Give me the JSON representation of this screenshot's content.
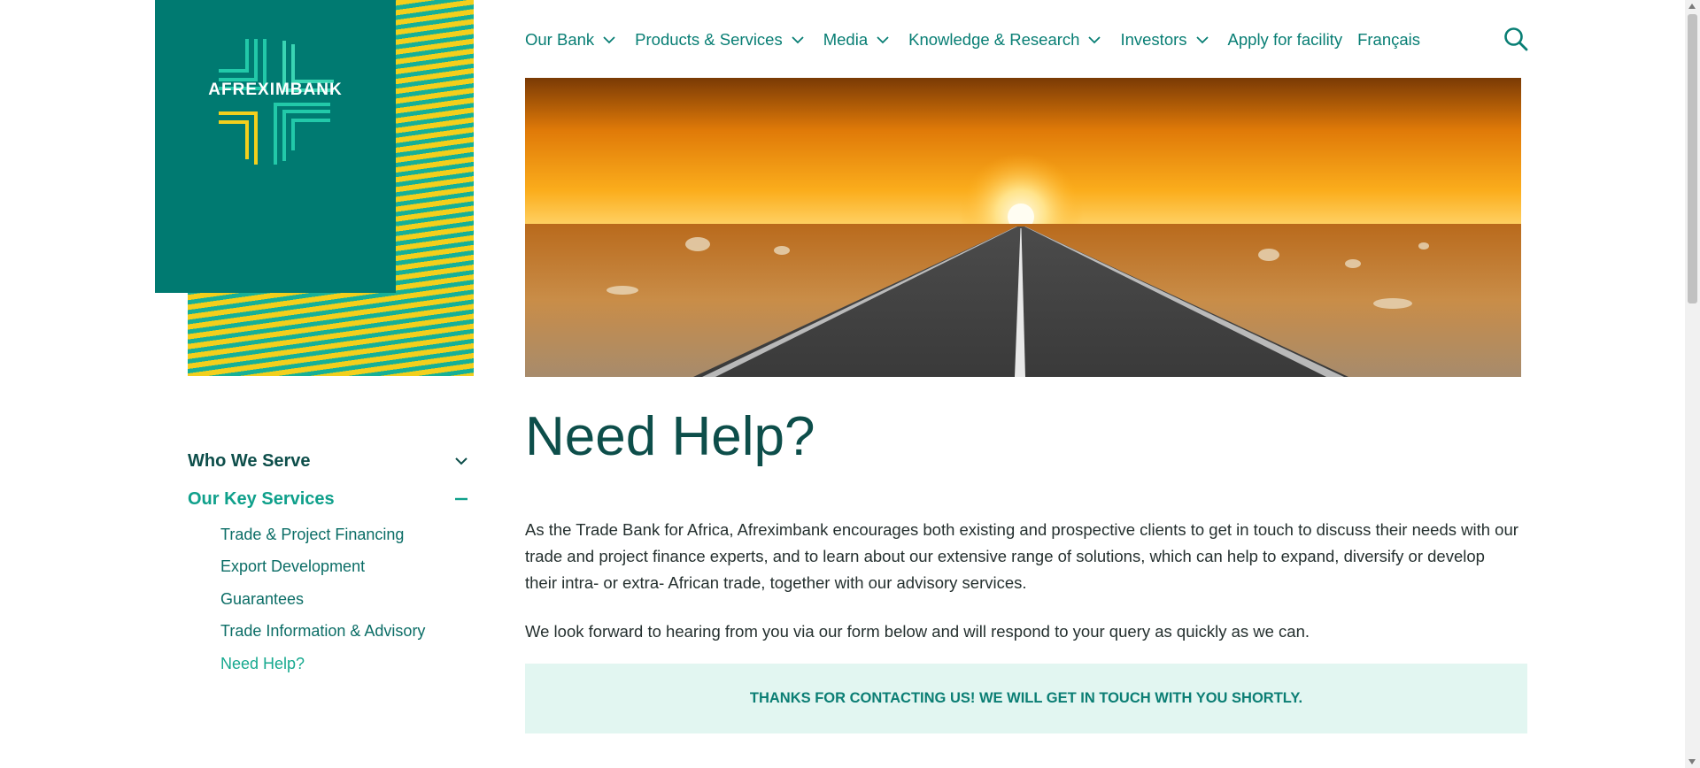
{
  "brand": {
    "logo_text": "AFREXIMBANK",
    "primary_color": "#007a71",
    "accent_yellow": "#f3cf1c",
    "accent_green": "#16b097"
  },
  "nav": {
    "items": [
      {
        "label": "Our Bank",
        "icon": "chevron-down-icon"
      },
      {
        "label": "Products & Services",
        "icon": "chevron-down-icon"
      },
      {
        "label": "Media",
        "icon": "chevron-down-icon"
      },
      {
        "label": "Knowledge & Research",
        "icon": "chevron-down-icon"
      },
      {
        "label": "Investors",
        "icon": "chevron-down-icon"
      }
    ],
    "apply_label": "Apply for facility",
    "language_label": "Français",
    "search_icon": "search-icon"
  },
  "sidebar": {
    "who_we_serve": "Who We Serve",
    "our_key_services": "Our Key Services",
    "sub_items": [
      "Trade & Project Financing",
      "Export Development",
      "Guarantees",
      "Trade Information & Advisory",
      "Need Help?"
    ]
  },
  "main": {
    "title": "Need Help?",
    "paragraph_1": "As the Trade Bank for Africa, Afreximbank encourages both existing and prospective clients to get in touch to discuss their needs with our trade and project finance experts, and to learn about our extensive range of solutions, which can help to expand, diversify or develop their intra- or extra- African trade, together with our advisory services.",
    "paragraph_2": "We look forward to hearing from you via our form below and will respond to your query as quickly as we can.",
    "notice": "THANKS FOR CONTACTING US! WE WILL GET IN TOUCH WITH YOU SHORTLY."
  }
}
